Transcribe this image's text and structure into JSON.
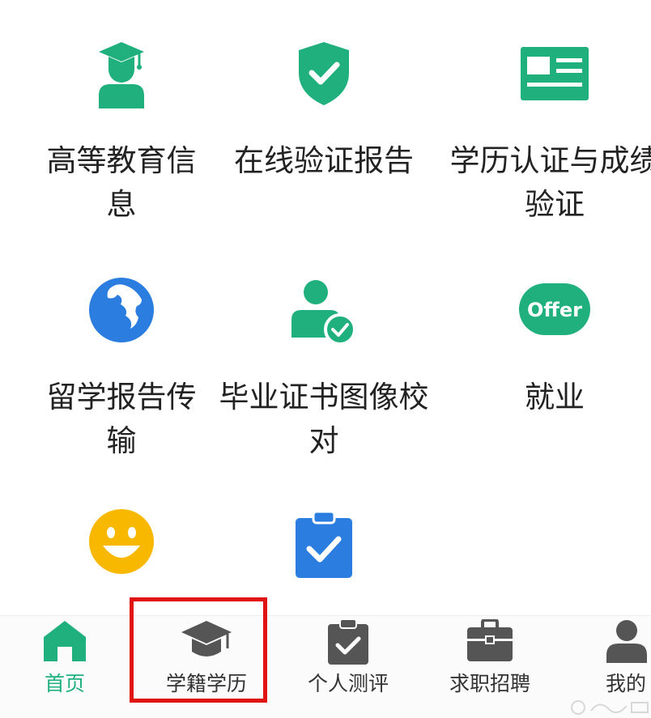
{
  "grid": {
    "items": [
      {
        "label": "高等教育信\n息",
        "icon": "graduate-icon"
      },
      {
        "label": "在线验证报告",
        "icon": "shield-check-icon"
      },
      {
        "label": "学历认证与成绩\n验证",
        "icon": "id-card-icon"
      },
      {
        "label": "留学报告传\n输",
        "icon": "globe-icon"
      },
      {
        "label": "毕业证书图像校\n对",
        "icon": "user-check-icon"
      },
      {
        "label": "就业",
        "icon": "offer-badge-icon",
        "badge_text": "Offer"
      },
      {
        "label": "",
        "icon": "smile-icon"
      },
      {
        "label": "",
        "icon": "clipboard-check-icon"
      }
    ]
  },
  "tabbar": {
    "tabs": [
      {
        "label": "首页",
        "icon": "home-icon",
        "active": true
      },
      {
        "label": "学籍学历",
        "icon": "mortarboard-icon",
        "active": false
      },
      {
        "label": "个人测评",
        "icon": "clipboard-check-icon",
        "active": false
      },
      {
        "label": "求职招聘",
        "icon": "briefcase-icon",
        "active": false
      },
      {
        "label": "我的",
        "icon": "person-icon",
        "active": false
      }
    ]
  },
  "colors": {
    "accent": "#20b07e",
    "blue": "#2b7de0",
    "yellow": "#f9b800",
    "tab_icon": "#555555",
    "highlight": "#e01212"
  }
}
